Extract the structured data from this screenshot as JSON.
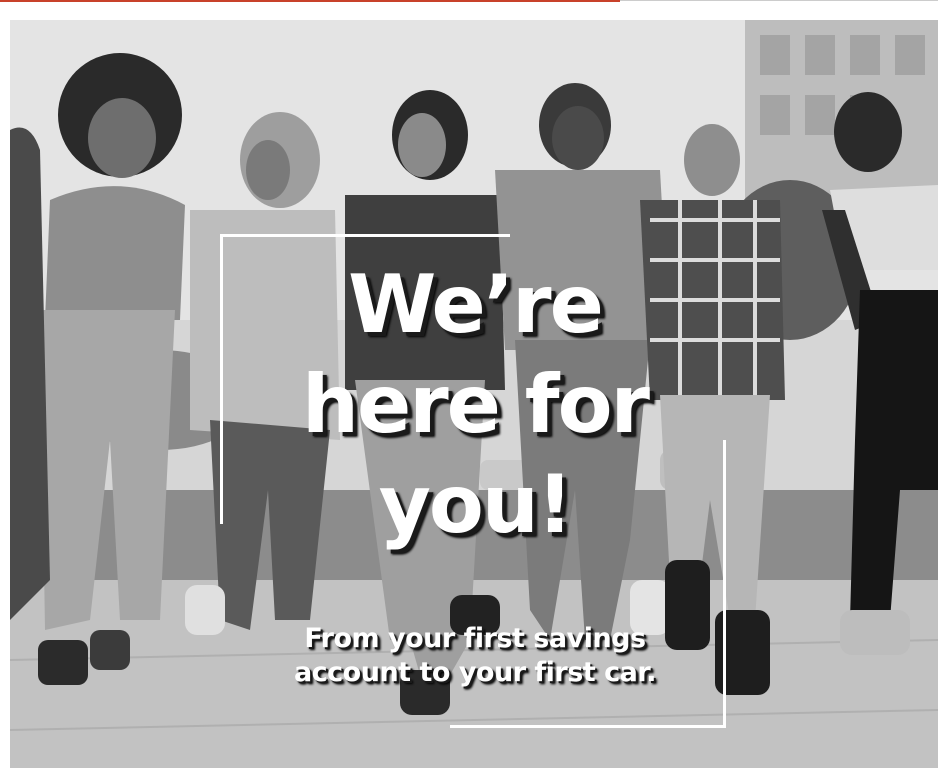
{
  "colors": {
    "accent": "#c8412a",
    "top_rule": "#cccccc",
    "frame": "#ffffff",
    "headline_text": "#ffffff",
    "headline_shadow": "#1a1a1a"
  },
  "hero": {
    "image": "grayscale-photo-group-of-young-people-walking-and-laughing",
    "headline": {
      "line1": "We’re",
      "line2": "here for",
      "line3": "you!"
    },
    "subhead": {
      "line1": "From your first savings",
      "line2": "account to your first car."
    }
  }
}
